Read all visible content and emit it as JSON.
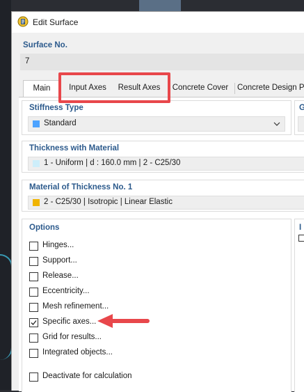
{
  "window": {
    "title": "Edit Surface"
  },
  "surface_no": {
    "label": "Surface No.",
    "value": "7"
  },
  "tabs": [
    {
      "label": "Main"
    },
    {
      "label": "Input Axes"
    },
    {
      "label": "Result Axes"
    },
    {
      "label": "Concrete Cover"
    },
    {
      "label": "Concrete Design Pro"
    }
  ],
  "stiffness": {
    "label": "Stiffness Type",
    "value": "Standard",
    "color": "#4da3ff"
  },
  "thickness": {
    "label": "Thickness with Material",
    "value": "1 - Uniform | d : 160.0 mm | 2 - C25/30",
    "color": "#cdeefa"
  },
  "material": {
    "label": "Material of Thickness No. 1",
    "value": "2 - C25/30 | Isotropic | Linear Elastic",
    "color": "#f0b400"
  },
  "right_group": {
    "label_top": "G",
    "label_options": "I"
  },
  "options": {
    "label": "Options",
    "items": [
      {
        "label": "Hinges...",
        "checked": false
      },
      {
        "label": "Support...",
        "checked": false
      },
      {
        "label": "Release...",
        "checked": false
      },
      {
        "label": "Eccentricity...",
        "checked": false
      },
      {
        "label": "Mesh refinement...",
        "checked": false
      },
      {
        "label": "Specific axes...",
        "checked": true
      },
      {
        "label": "Grid for results...",
        "checked": false
      },
      {
        "label": "Integrated objects...",
        "checked": false
      }
    ],
    "deactivate": {
      "label": "Deactivate for calculation",
      "checked": false
    }
  },
  "colors": {
    "accent": "#e8474b",
    "header_text": "#2c5a8c"
  }
}
